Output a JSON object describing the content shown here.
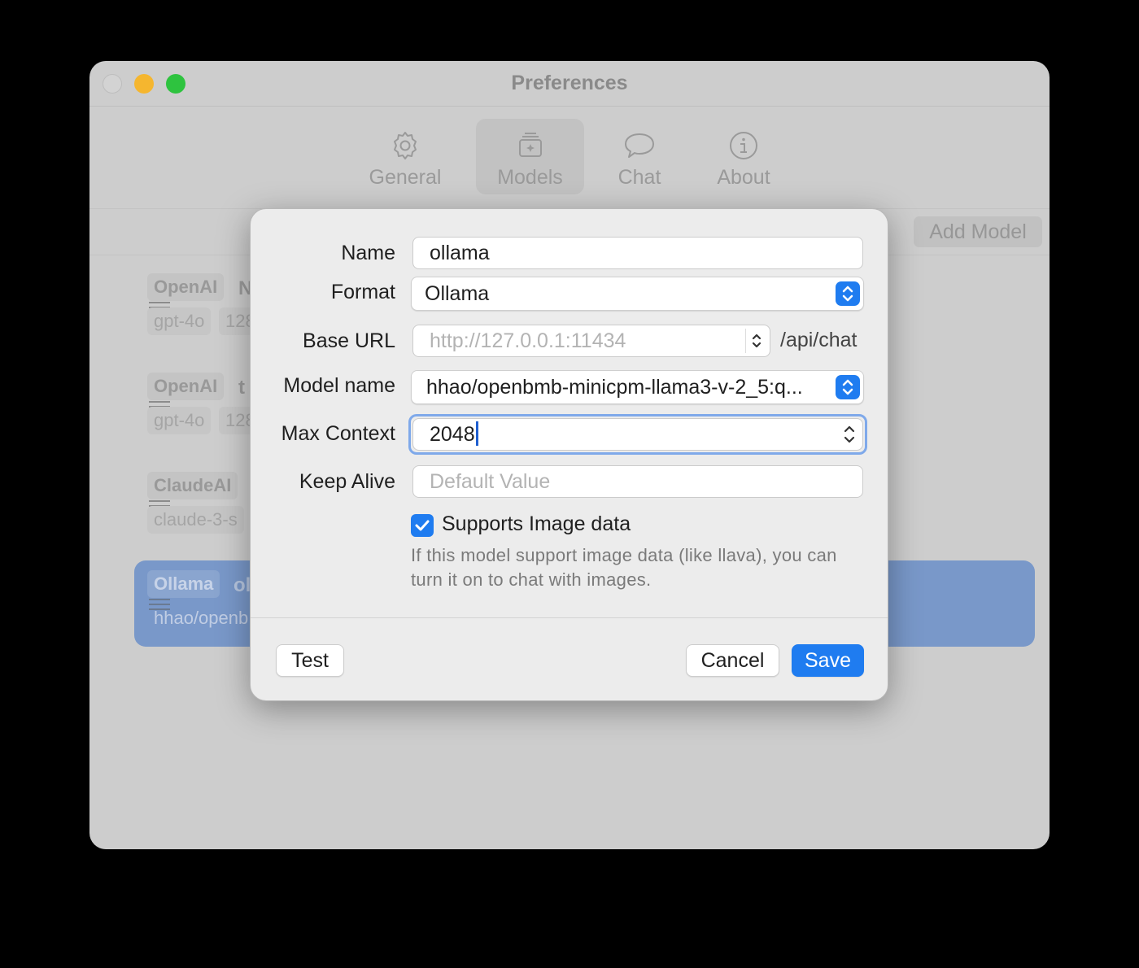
{
  "window": {
    "title": "Preferences"
  },
  "tabs": [
    {
      "id": "general",
      "label": "General",
      "icon": "gear-icon",
      "active": false
    },
    {
      "id": "models",
      "label": "Models",
      "icon": "models-icon",
      "active": true
    },
    {
      "id": "chat",
      "label": "Chat",
      "icon": "chat-bubble-icon",
      "active": false
    },
    {
      "id": "about",
      "label": "About",
      "icon": "info-icon",
      "active": false
    }
  ],
  "header": {
    "add_model_label": "Add Model"
  },
  "models": [
    {
      "provider": "OpenAI",
      "name_partial": "N",
      "model_partial": "gpt-4o",
      "ctx_partial": "128",
      "selected": false
    },
    {
      "provider": "OpenAI",
      "name_partial": "t",
      "model_partial": "gpt-4o",
      "ctx_partial": "128",
      "selected": false
    },
    {
      "provider": "ClaudeAI",
      "name_partial": "",
      "model_partial": "claude-3-s",
      "ctx_partial": "",
      "selected": false
    },
    {
      "provider": "Ollama",
      "name_partial": "ol",
      "model_partial": "hhao/openb",
      "ctx_partial": "",
      "selected": true
    }
  ],
  "sheet": {
    "name_label": "Name",
    "name_value": "ollama",
    "format_label": "Format",
    "format_value": "Ollama",
    "base_url_label": "Base URL",
    "base_url_placeholder": "http://127.0.0.1:11434",
    "base_url_suffix": "/api/chat",
    "model_name_label": "Model name",
    "model_name_value": "hhao/openbmb-minicpm-llama3-v-2_5:q...",
    "max_context_label": "Max Context",
    "max_context_value": "2048",
    "keep_alive_label": "Keep Alive",
    "keep_alive_placeholder": "Default Value",
    "supports_image_label": "Supports Image data",
    "supports_image_checked": true,
    "help_text": "If this model support image data (like llava), you can turn it on to chat with images.",
    "test_label": "Test",
    "cancel_label": "Cancel",
    "save_label": "Save"
  },
  "colors": {
    "accent": "#1f7cf0",
    "selection": "#7998c9"
  }
}
